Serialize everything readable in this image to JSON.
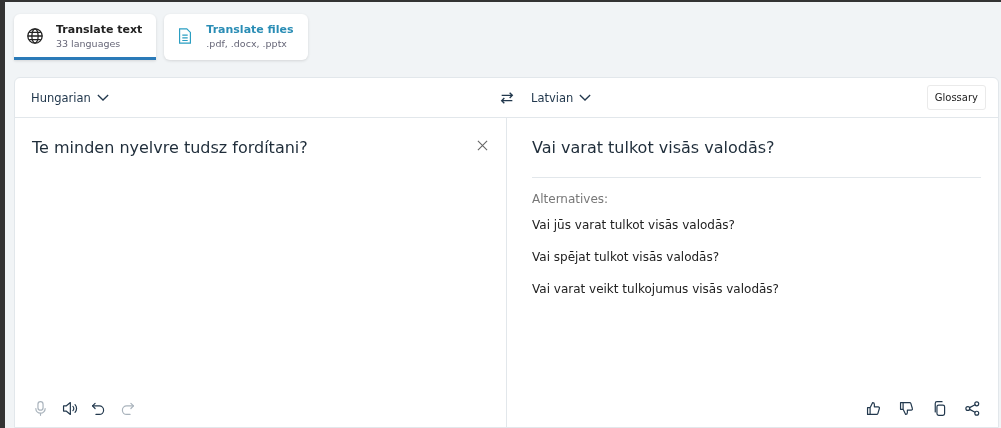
{
  "tabs": [
    {
      "kind": "globe",
      "title": "Translate text",
      "subtitle": "33 languages",
      "selected": true
    },
    {
      "kind": "file",
      "title": "Translate files",
      "subtitle": ".pdf, .docx, .pptx",
      "selected": false
    }
  ],
  "source": {
    "language": "Hungarian",
    "text": "Te minden nyelvre tudsz fordítani?",
    "tools": [
      {
        "kind": "mic",
        "disabled": true
      },
      {
        "kind": "speaker",
        "disabled": false
      },
      {
        "kind": "undo",
        "disabled": false
      },
      {
        "kind": "redo",
        "disabled": true
      }
    ]
  },
  "target": {
    "language": "Latvian",
    "glossary": "Glossary",
    "text": "Vai varat tulkot visās valodās?",
    "alternatives_label": "Alternatives:",
    "alternatives": [
      "Vai jūs varat tulkot visās valodās?",
      "Vai spējat tulkot visās valodās?",
      "Vai varat veikt tulkojumus visās valodās?"
    ],
    "tools": [
      {
        "kind": "thumbs-up"
      },
      {
        "kind": "thumbs-down"
      },
      {
        "kind": "copy"
      },
      {
        "kind": "share"
      }
    ]
  }
}
